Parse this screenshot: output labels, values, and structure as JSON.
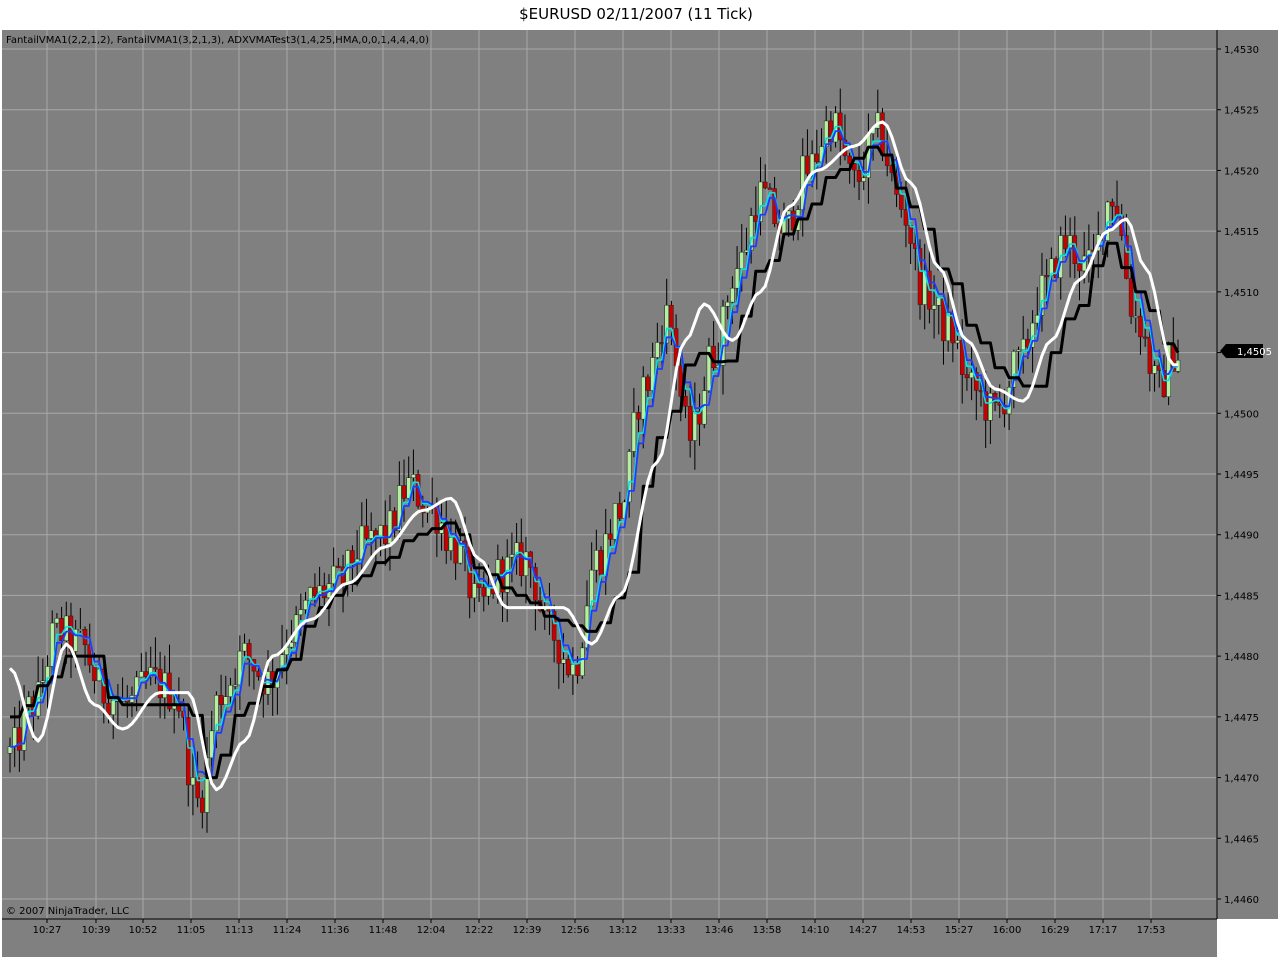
{
  "window": {
    "title": "$EURUSD  02/11/2007  (11 Tick)"
  },
  "indicators_label": "FantailVMA1(2,2,1,2), FantailVMA1(3,2,1,3), ADXVMATest3(1,4,25,HMA,0,0,1,4,4,4,0)",
  "copyright": "© 2007 NinjaTrader, LLC",
  "colors": {
    "background": "#808080",
    "grid": "#a8a8a8",
    "up_candle": "#b4f0a0",
    "down_candle": "#c80000",
    "wick": "#000000",
    "fast_vma": "#00e6e6",
    "mid_vma": "#1e3cff",
    "adxvma": "#000000",
    "hma": "#ffffff"
  },
  "chart_data": {
    "type": "candlestick",
    "title": "$EURUSD  02/11/2007  (11 Tick)",
    "xlabel": "",
    "ylabel": "",
    "ylim": [
      1.446,
      1.453
    ],
    "grid": true,
    "legend": "top-left text",
    "y_ticks": [
      "1,4460",
      "1,4465",
      "1,4470",
      "1,4475",
      "1,4480",
      "1,4485",
      "1,4490",
      "1,4495",
      "1,4500",
      "1,4505",
      "1,4510",
      "1,4515",
      "1,4520",
      "1,4525",
      "1,4530"
    ],
    "x_ticks": [
      "10:27",
      "10:39",
      "10:52",
      "11:05",
      "11:13",
      "11:24",
      "11:36",
      "11:48",
      "12:04",
      "12:22",
      "12:39",
      "12:56",
      "13:12",
      "13:33",
      "13:46",
      "13:58",
      "14:10",
      "14:27",
      "14:53",
      "15:27",
      "16:00",
      "16:29",
      "17:17",
      "17:53"
    ],
    "last_price": "1,4505",
    "price_keypoints": [
      [
        0,
        1.4472
      ],
      [
        5,
        1.4476
      ],
      [
        10,
        1.4482
      ],
      [
        15,
        1.4481
      ],
      [
        20,
        1.4477
      ],
      [
        25,
        1.4476
      ],
      [
        30,
        1.4478
      ],
      [
        35,
        1.4477
      ],
      [
        40,
        1.4468
      ],
      [
        45,
        1.4477
      ],
      [
        50,
        1.448
      ],
      [
        55,
        1.4478
      ],
      [
        60,
        1.4482
      ],
      [
        65,
        1.4485
      ],
      [
        70,
        1.4486
      ],
      [
        75,
        1.4489
      ],
      [
        80,
        1.449
      ],
      [
        85,
        1.4494
      ],
      [
        90,
        1.4492
      ],
      [
        95,
        1.4489
      ],
      [
        100,
        1.4484
      ],
      [
        105,
        1.4487
      ],
      [
        110,
        1.4488
      ],
      [
        115,
        1.4482
      ],
      [
        120,
        1.4479
      ],
      [
        125,
        1.4488
      ],
      [
        130,
        1.4492
      ],
      [
        135,
        1.4502
      ],
      [
        140,
        1.4508
      ],
      [
        145,
        1.4498
      ],
      [
        150,
        1.4505
      ],
      [
        155,
        1.4512
      ],
      [
        160,
        1.4518
      ],
      [
        165,
        1.4515
      ],
      [
        170,
        1.452
      ],
      [
        175,
        1.4524
      ],
      [
        180,
        1.4519
      ],
      [
        185,
        1.4523
      ],
      [
        190,
        1.4517
      ],
      [
        195,
        1.451
      ],
      [
        200,
        1.4507
      ],
      [
        205,
        1.4502
      ],
      [
        210,
        1.45
      ],
      [
        215,
        1.4504
      ],
      [
        220,
        1.451
      ],
      [
        225,
        1.4514
      ],
      [
        230,
        1.4512
      ],
      [
        235,
        1.4518
      ],
      [
        240,
        1.4508
      ],
      [
        245,
        1.4502
      ],
      [
        248,
        1.4505
      ]
    ],
    "series": [
      {
        "name": "ADXVMATest3 (black)",
        "keypoints": [
          [
            0,
            1.4475
          ],
          [
            8,
            1.4478
          ],
          [
            12,
            1.448
          ],
          [
            18,
            1.448
          ],
          [
            22,
            1.4476
          ],
          [
            38,
            1.4476
          ],
          [
            42,
            1.447
          ],
          [
            50,
            1.4476
          ],
          [
            58,
            1.4479
          ],
          [
            66,
            1.4484
          ],
          [
            72,
            1.4486
          ],
          [
            80,
            1.4488
          ],
          [
            86,
            1.449
          ],
          [
            94,
            1.4491
          ],
          [
            100,
            1.4487
          ],
          [
            108,
            1.4485
          ],
          [
            116,
            1.4483
          ],
          [
            124,
            1.4482
          ],
          [
            130,
            1.4485
          ],
          [
            138,
            1.4498
          ],
          [
            146,
            1.4505
          ],
          [
            152,
            1.4504
          ],
          [
            160,
            1.4512
          ],
          [
            168,
            1.4516
          ],
          [
            176,
            1.452
          ],
          [
            184,
            1.4522
          ],
          [
            192,
            1.4517
          ],
          [
            200,
            1.4511
          ],
          [
            206,
            1.4506
          ],
          [
            212,
            1.4503
          ],
          [
            218,
            1.4502
          ],
          [
            226,
            1.4508
          ],
          [
            234,
            1.4514
          ],
          [
            240,
            1.451
          ],
          [
            248,
            1.4505
          ]
        ]
      },
      {
        "name": "HMA (white)",
        "keypoints": [
          [
            0,
            1.4479
          ],
          [
            6,
            1.4473
          ],
          [
            12,
            1.4481
          ],
          [
            18,
            1.4476
          ],
          [
            24,
            1.4474
          ],
          [
            32,
            1.4477
          ],
          [
            38,
            1.4477
          ],
          [
            44,
            1.4469
          ],
          [
            50,
            1.4473
          ],
          [
            56,
            1.448
          ],
          [
            64,
            1.4483
          ],
          [
            72,
            1.4486
          ],
          [
            80,
            1.4489
          ],
          [
            88,
            1.4492
          ],
          [
            94,
            1.4493
          ],
          [
            100,
            1.4488
          ],
          [
            106,
            1.4484
          ],
          [
            112,
            1.4484
          ],
          [
            118,
            1.4484
          ],
          [
            124,
            1.4481
          ],
          [
            130,
            1.4485
          ],
          [
            138,
            1.4496
          ],
          [
            144,
            1.4506
          ],
          [
            148,
            1.4509
          ],
          [
            154,
            1.4506
          ],
          [
            160,
            1.451
          ],
          [
            166,
            1.4517
          ],
          [
            172,
            1.452
          ],
          [
            180,
            1.4522
          ],
          [
            186,
            1.4524
          ],
          [
            192,
            1.4519
          ],
          [
            198,
            1.4512
          ],
          [
            204,
            1.4506
          ],
          [
            210,
            1.4502
          ],
          [
            216,
            1.4501
          ],
          [
            222,
            1.4506
          ],
          [
            228,
            1.4511
          ],
          [
            234,
            1.4515
          ],
          [
            238,
            1.4516
          ],
          [
            242,
            1.4512
          ],
          [
            248,
            1.4504
          ]
        ]
      },
      {
        "name": "FantailVMA1 (2,2,1,2) cyan",
        "keypoints": []
      },
      {
        "name": "FantailVMA1 (3,2,1,3) blue",
        "keypoints": []
      }
    ]
  }
}
